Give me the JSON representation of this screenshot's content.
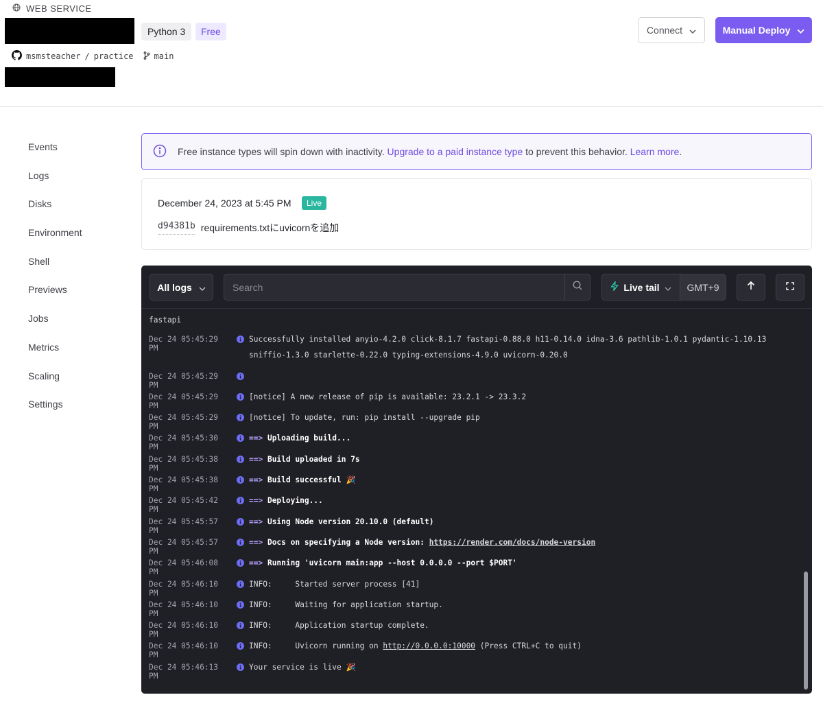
{
  "header": {
    "service_type": "WEB SERVICE",
    "runtime_badge": "Python 3",
    "plan_badge": "Free",
    "repo_owner": "msmsteacher",
    "repo_sep": "/",
    "repo_name": "practice",
    "branch": "main",
    "connect_label": "Connect",
    "deploy_label": "Manual Deploy"
  },
  "sidebar": {
    "items": [
      {
        "label": "Events"
      },
      {
        "label": "Logs"
      },
      {
        "label": "Disks"
      },
      {
        "label": "Environment"
      },
      {
        "label": "Shell"
      },
      {
        "label": "Previews"
      },
      {
        "label": "Jobs"
      },
      {
        "label": "Metrics"
      },
      {
        "label": "Scaling"
      },
      {
        "label": "Settings"
      }
    ]
  },
  "banner": {
    "text_before": "Free instance types will spin down with inactivity.",
    "link_upgrade": "Upgrade to a paid instance type",
    "text_middle": "to prevent this behavior.",
    "link_learn": "Learn more",
    "text_end": "."
  },
  "deploy": {
    "date": "December 24, 2023 at 5:45 PM",
    "status": "Live",
    "commit_hash": "d94381b",
    "commit_message": "requirements.txtにuvicornを追加"
  },
  "logs": {
    "filter_label": "All logs",
    "search_placeholder": "Search",
    "live_tail_label": "Live tail",
    "timezone": "GMT+9",
    "partial_line": "fastapi",
    "entries": [
      {
        "ts": "Dec 24 05:45:29 PM",
        "msg": "Successfully installed anyio-4.2.0 click-8.1.7 fastapi-0.88.0 h11-0.14.0 idna-3.6 pathlib-1.0.1 pydantic-1.10.13 sniffio-1.3.0 starlette-0.22.0 typing-extensions-4.9.0 uvicorn-0.20.0"
      },
      {
        "ts": "Dec 24 05:45:29 PM",
        "msg": ""
      },
      {
        "ts": "Dec 24 05:45:29 PM",
        "msg": "[notice] A new release of pip is available: 23.2.1 -> 23.3.2"
      },
      {
        "ts": "Dec 24 05:45:29 PM",
        "msg": "[notice] To update, run: pip install --upgrade pip"
      },
      {
        "ts": "Dec 24 05:45:30 PM",
        "arrow": "==>",
        "msg": "Uploading build..."
      },
      {
        "ts": "Dec 24 05:45:38 PM",
        "arrow": "==>",
        "msg": "Build uploaded in 7s"
      },
      {
        "ts": "Dec 24 05:45:38 PM",
        "arrow": "==>",
        "msg": "Build successful 🎉"
      },
      {
        "ts": "Dec 24 05:45:42 PM",
        "arrow": "==>",
        "msg": "Deploying..."
      },
      {
        "ts": "Dec 24 05:45:57 PM",
        "arrow": "==>",
        "msg": "Using Node version 20.10.0 (default)"
      },
      {
        "ts": "Dec 24 05:45:57 PM",
        "arrow": "==>",
        "msg": "Docs on specifying a Node version: ",
        "link": "https://render.com/docs/node-version"
      },
      {
        "ts": "Dec 24 05:46:08 PM",
        "arrow": "==>",
        "msg": "Running 'uvicorn main:app --host 0.0.0.0 --port $PORT'"
      },
      {
        "ts": "Dec 24 05:46:10 PM",
        "msg": "INFO:     Started server process [41]"
      },
      {
        "ts": "Dec 24 05:46:10 PM",
        "msg": "INFO:     Waiting for application startup."
      },
      {
        "ts": "Dec 24 05:46:10 PM",
        "msg": "INFO:     Application startup complete."
      },
      {
        "ts": "Dec 24 05:46:10 PM",
        "msg": "INFO:     Uvicorn running on ",
        "link": "http://0.0.0.0:10000",
        "msg_after": " (Press CTRL+C to quit)"
      },
      {
        "ts": "Dec 24 05:46:13 PM",
        "msg": "Your service is live 🎉"
      }
    ]
  },
  "colors": {
    "accent": "#7b5cf0",
    "live_badge": "#2bb6a0",
    "log_bg": "#1f1f26",
    "info_icon": "#6d6df5"
  },
  "icons": [
    "globe-icon",
    "github-icon",
    "branch-icon",
    "chevron-down-icon",
    "info-icon",
    "search-icon",
    "lightning-icon",
    "arrow-up-icon",
    "expand-icon"
  ]
}
